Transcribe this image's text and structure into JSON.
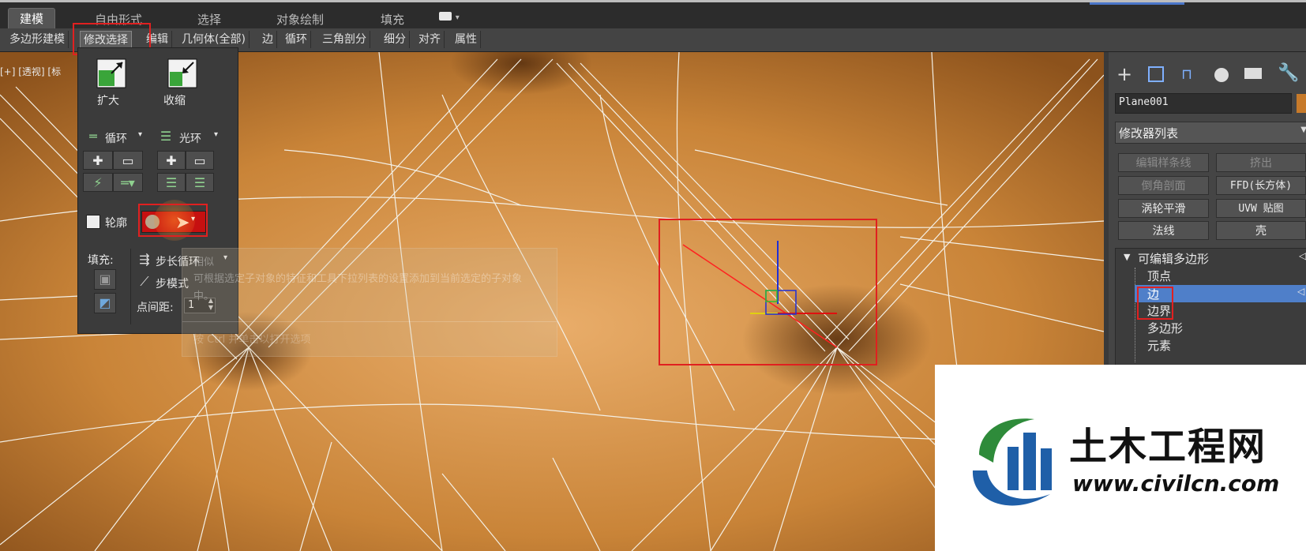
{
  "ribbon": {
    "tabs": [
      "建模",
      "自由形式",
      "选择",
      "对象绘制",
      "填充"
    ],
    "toolbar": [
      "多边形建模",
      "修改选择",
      "编辑",
      "几何体(全部)",
      "边",
      "循环",
      "三角剖分",
      "细分",
      "对齐",
      "属性"
    ]
  },
  "viewport": {
    "label": "[+] [透视] [标"
  },
  "modify_panel": {
    "grow": "扩大",
    "shrink": "收缩",
    "loop": "循环",
    "ring": "光环",
    "outline": "轮廓",
    "fill": "填充:",
    "step_loop": "步长循环",
    "step_mode": "步模式",
    "dot_gap_label": "点间距:",
    "dot_gap_value": "1"
  },
  "tooltip": {
    "title": "相似",
    "body": "可根据选定子对象的特征和工具下拉列表的设置添加到当前选定的子对象中。",
    "footer": "按 Ctrl 并单击以打开选项"
  },
  "command_panel": {
    "object_name": "Plane001",
    "object_color": "#c77a2a",
    "modifier_list": "修改器列表",
    "buttons": [
      "编辑样条线",
      "挤出",
      "倒角剖面",
      "FFD(长方体)",
      "涡轮平滑",
      "UVW 贴图",
      "法线",
      "壳"
    ],
    "stack_root": "可编辑多边形",
    "stack_items": [
      "顶点",
      "边",
      "边界",
      "多边形",
      "元素"
    ],
    "selected_item": "边"
  },
  "watermark": {
    "name": "土木工程网",
    "url": "www.civilcn.com"
  },
  "colors": {
    "highlight": "#e02020",
    "selection_blue": "#4f7fc9",
    "mesh": "#b06e2c"
  }
}
